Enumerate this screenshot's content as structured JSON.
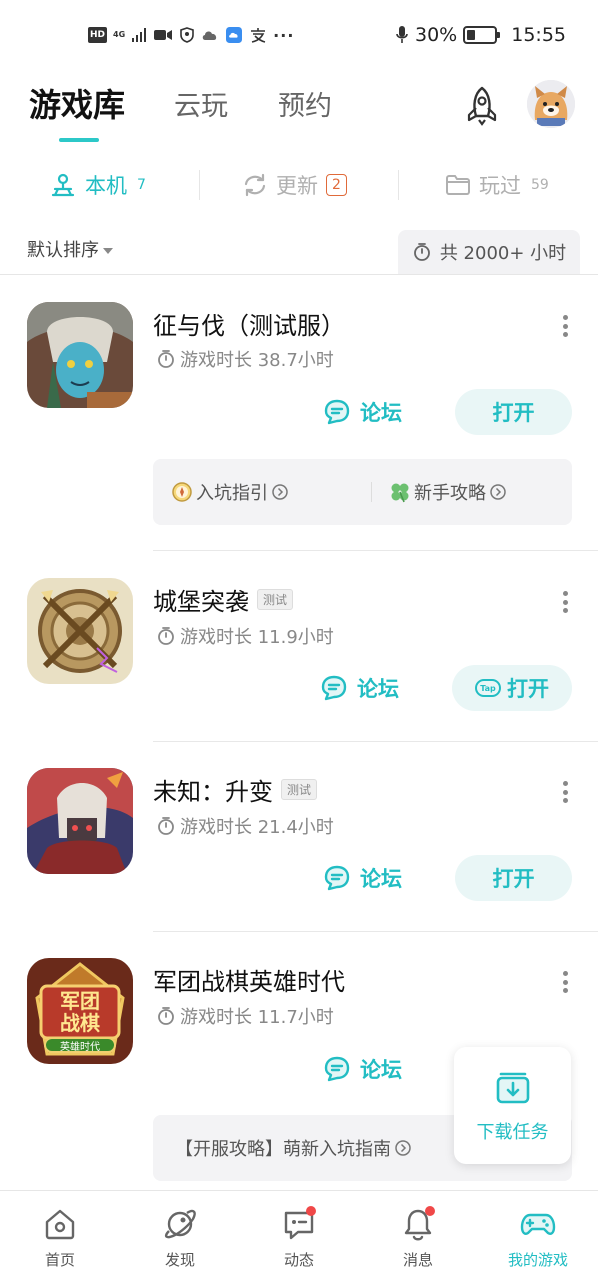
{
  "status_bar": {
    "network": "4G",
    "hd": "HD",
    "battery": "30%",
    "battery_level": 0.3,
    "time": "15:55",
    "more": "···"
  },
  "header": {
    "tabs": [
      {
        "label": "游戏库",
        "active": true
      },
      {
        "label": "云玩",
        "active": false
      },
      {
        "label": "预约",
        "active": false
      }
    ],
    "rocket_icon": "rocket-icon",
    "avatar_icon": "avatar-dog-icon"
  },
  "subtabs": [
    {
      "label": "本机",
      "count": "7",
      "icon": "local-device-icon",
      "active": true
    },
    {
      "label": "更新",
      "count": "2",
      "icon": "refresh-icon",
      "active": false
    },
    {
      "label": "玩过",
      "count": "59",
      "icon": "folder-icon",
      "active": false
    }
  ],
  "sort": {
    "label": "默认排序",
    "total_time": "共 2000+ 小时"
  },
  "games": [
    {
      "title": "征与伐（测试服）",
      "tag": "",
      "playtime": "游戏时长 38.7小时",
      "forum": "论坛",
      "open": "打开",
      "guides": [
        "入坑指引",
        "新手攻略"
      ]
    },
    {
      "title": "城堡突袭",
      "tag": "测试",
      "playtime": "游戏时长 11.9小时",
      "forum": "论坛",
      "open": "打开",
      "tap_logo": "Tap"
    },
    {
      "title": "未知：升变",
      "tag": "测试",
      "playtime": "游戏时长 21.4小时",
      "forum": "论坛",
      "open": "打开"
    },
    {
      "title": "军团战棋英雄时代",
      "tag": "",
      "playtime": "游戏时长 11.7小时",
      "forum": "论坛",
      "guide": "【开服攻略】萌新入坑指南"
    }
  ],
  "download_float": {
    "label": "下载任务"
  },
  "bottom_nav": [
    {
      "label": "首页",
      "icon": "home-icon",
      "active": false,
      "dot": false
    },
    {
      "label": "发现",
      "icon": "planet-icon",
      "active": false,
      "dot": false
    },
    {
      "label": "动态",
      "icon": "chat-icon",
      "active": false,
      "dot": true
    },
    {
      "label": "消息",
      "icon": "bell-icon",
      "active": false,
      "dot": true
    },
    {
      "label": "我的游戏",
      "icon": "gamepad-icon",
      "active": true,
      "dot": false
    }
  ],
  "colors": {
    "accent": "#22bdc3",
    "badge": "#e06a3a",
    "red_dot": "#f04848"
  }
}
